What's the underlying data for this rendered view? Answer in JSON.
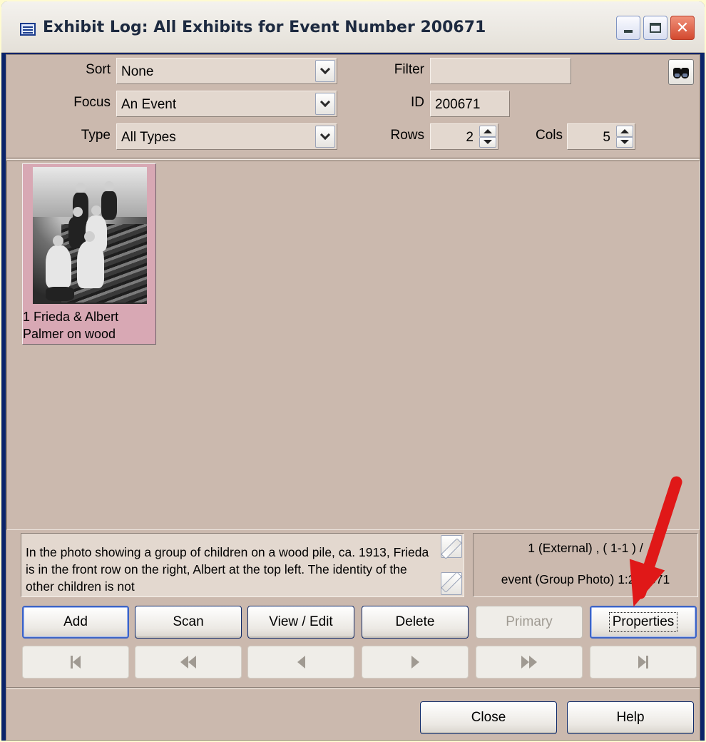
{
  "window": {
    "title": "Exhibit Log: All Exhibits for Event Number 200671"
  },
  "filters": {
    "sort_label": "Sort",
    "sort_value": "None",
    "focus_label": "Focus",
    "focus_value": "An Event",
    "type_label": "Type",
    "type_value": "All Types",
    "filter_label": "Filter",
    "filter_value": "",
    "id_label": "ID",
    "id_value": "200671",
    "rows_label": "Rows",
    "rows_value": "2",
    "cols_label": "Cols",
    "cols_value": "5"
  },
  "exhibits": [
    {
      "caption": "1 Frieda & Albert\nPalmer on wood",
      "highlight_color": "#d8a8b4"
    }
  ],
  "details": {
    "memo": "In the photo showing a group of children on a wood pile, ca. 1913, Frieda is in the front row on the right, Albert at the top left.  The identity of the other children is not",
    "info_line1": "1 (External) , ( 1-1 ) /",
    "info_line2": "event (Group Photo) 1:200671"
  },
  "buttons": {
    "add": "Add",
    "scan": "Scan",
    "view_edit": "View / Edit",
    "delete": "Delete",
    "primary": "Primary",
    "properties": "Properties",
    "close": "Close",
    "help": "Help"
  },
  "colors": {
    "client_bg": "#cbb9ae",
    "annotation_arrow": "#e01818"
  }
}
